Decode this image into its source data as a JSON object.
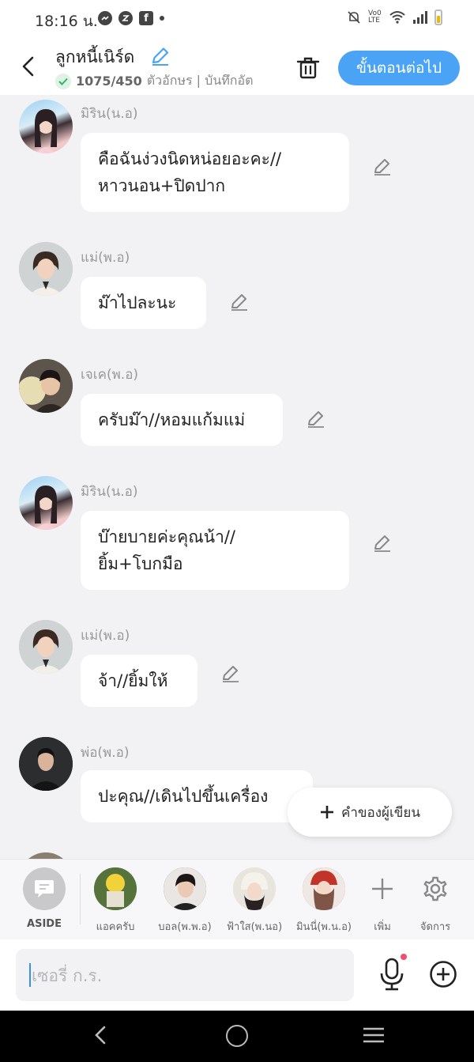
{
  "status_bar": {
    "time": "18:16 น.",
    "icon_left": [
      "messenger-icon",
      "threads-icon",
      "facebook-icon",
      "dot"
    ],
    "sq_glyph": "f",
    "network": "Vo0 LTE"
  },
  "header": {
    "title": "ลูกหนี้เนิร์ด",
    "count": "1075/450",
    "subtitle_rest": "ตัวอักษร | บันทึกอัต",
    "next_label": "ขั้นตอนต่อไป"
  },
  "messages": [
    {
      "speaker": "มิริน(น.อ)",
      "text": [
        "คือฉันง่วงนิดหน่อยอะคะ//",
        "หาวนอน+ปิดปาก"
      ]
    },
    {
      "speaker": "แม่(พ.อ)",
      "text": [
        "ม๊าไปละนะ"
      ]
    },
    {
      "speaker": "เจเค(พ.อ)",
      "text": [
        "ครับม๊า//หอมแก้มแม่"
      ]
    },
    {
      "speaker": "มิริน(น.อ)",
      "text": [
        "บ๊ายบายค่ะคุณน้า//",
        "ยิ้ม+โบกมือ"
      ]
    },
    {
      "speaker": "แม่(พ.อ)",
      "text": [
        "จ้า//ยิ้มให้"
      ]
    },
    {
      "speaker": "พ่อ(พ.อ)",
      "text": [
        "ปะคุณ//เดินไปขึ้นเครื่อง"
      ]
    }
  ],
  "fab": {
    "label": "คำของผู้เขียน"
  },
  "characters": {
    "aside_label": "ASIDE",
    "items": [
      "แอคครับ",
      "บอล(พ.พ.อ)",
      "ฟ้าใส(พ.นอ)",
      "มินนี่(พ.น.อ)"
    ],
    "add_label": "เพิ่ม",
    "manage_label": "จัดการ"
  },
  "input": {
    "placeholder": "เซอรี่ ก.ร."
  }
}
